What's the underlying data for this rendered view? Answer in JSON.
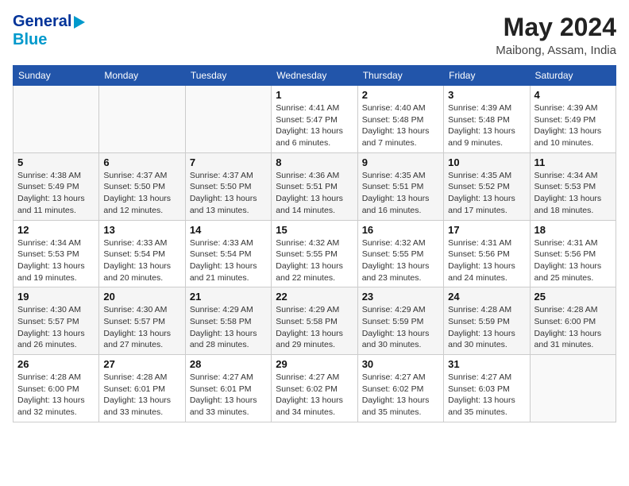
{
  "header": {
    "logo_line1": "General",
    "logo_line2": "Blue",
    "month_year": "May 2024",
    "location": "Maibong, Assam, India"
  },
  "weekdays": [
    "Sunday",
    "Monday",
    "Tuesday",
    "Wednesday",
    "Thursday",
    "Friday",
    "Saturday"
  ],
  "weeks": [
    [
      {
        "day": "",
        "info": ""
      },
      {
        "day": "",
        "info": ""
      },
      {
        "day": "",
        "info": ""
      },
      {
        "day": "1",
        "info": "Sunrise: 4:41 AM\nSunset: 5:47 PM\nDaylight: 13 hours\nand 6 minutes."
      },
      {
        "day": "2",
        "info": "Sunrise: 4:40 AM\nSunset: 5:48 PM\nDaylight: 13 hours\nand 7 minutes."
      },
      {
        "day": "3",
        "info": "Sunrise: 4:39 AM\nSunset: 5:48 PM\nDaylight: 13 hours\nand 9 minutes."
      },
      {
        "day": "4",
        "info": "Sunrise: 4:39 AM\nSunset: 5:49 PM\nDaylight: 13 hours\nand 10 minutes."
      }
    ],
    [
      {
        "day": "5",
        "info": "Sunrise: 4:38 AM\nSunset: 5:49 PM\nDaylight: 13 hours\nand 11 minutes."
      },
      {
        "day": "6",
        "info": "Sunrise: 4:37 AM\nSunset: 5:50 PM\nDaylight: 13 hours\nand 12 minutes."
      },
      {
        "day": "7",
        "info": "Sunrise: 4:37 AM\nSunset: 5:50 PM\nDaylight: 13 hours\nand 13 minutes."
      },
      {
        "day": "8",
        "info": "Sunrise: 4:36 AM\nSunset: 5:51 PM\nDaylight: 13 hours\nand 14 minutes."
      },
      {
        "day": "9",
        "info": "Sunrise: 4:35 AM\nSunset: 5:51 PM\nDaylight: 13 hours\nand 16 minutes."
      },
      {
        "day": "10",
        "info": "Sunrise: 4:35 AM\nSunset: 5:52 PM\nDaylight: 13 hours\nand 17 minutes."
      },
      {
        "day": "11",
        "info": "Sunrise: 4:34 AM\nSunset: 5:53 PM\nDaylight: 13 hours\nand 18 minutes."
      }
    ],
    [
      {
        "day": "12",
        "info": "Sunrise: 4:34 AM\nSunset: 5:53 PM\nDaylight: 13 hours\nand 19 minutes."
      },
      {
        "day": "13",
        "info": "Sunrise: 4:33 AM\nSunset: 5:54 PM\nDaylight: 13 hours\nand 20 minutes."
      },
      {
        "day": "14",
        "info": "Sunrise: 4:33 AM\nSunset: 5:54 PM\nDaylight: 13 hours\nand 21 minutes."
      },
      {
        "day": "15",
        "info": "Sunrise: 4:32 AM\nSunset: 5:55 PM\nDaylight: 13 hours\nand 22 minutes."
      },
      {
        "day": "16",
        "info": "Sunrise: 4:32 AM\nSunset: 5:55 PM\nDaylight: 13 hours\nand 23 minutes."
      },
      {
        "day": "17",
        "info": "Sunrise: 4:31 AM\nSunset: 5:56 PM\nDaylight: 13 hours\nand 24 minutes."
      },
      {
        "day": "18",
        "info": "Sunrise: 4:31 AM\nSunset: 5:56 PM\nDaylight: 13 hours\nand 25 minutes."
      }
    ],
    [
      {
        "day": "19",
        "info": "Sunrise: 4:30 AM\nSunset: 5:57 PM\nDaylight: 13 hours\nand 26 minutes."
      },
      {
        "day": "20",
        "info": "Sunrise: 4:30 AM\nSunset: 5:57 PM\nDaylight: 13 hours\nand 27 minutes."
      },
      {
        "day": "21",
        "info": "Sunrise: 4:29 AM\nSunset: 5:58 PM\nDaylight: 13 hours\nand 28 minutes."
      },
      {
        "day": "22",
        "info": "Sunrise: 4:29 AM\nSunset: 5:58 PM\nDaylight: 13 hours\nand 29 minutes."
      },
      {
        "day": "23",
        "info": "Sunrise: 4:29 AM\nSunset: 5:59 PM\nDaylight: 13 hours\nand 30 minutes."
      },
      {
        "day": "24",
        "info": "Sunrise: 4:28 AM\nSunset: 5:59 PM\nDaylight: 13 hours\nand 30 minutes."
      },
      {
        "day": "25",
        "info": "Sunrise: 4:28 AM\nSunset: 6:00 PM\nDaylight: 13 hours\nand 31 minutes."
      }
    ],
    [
      {
        "day": "26",
        "info": "Sunrise: 4:28 AM\nSunset: 6:00 PM\nDaylight: 13 hours\nand 32 minutes."
      },
      {
        "day": "27",
        "info": "Sunrise: 4:28 AM\nSunset: 6:01 PM\nDaylight: 13 hours\nand 33 minutes."
      },
      {
        "day": "28",
        "info": "Sunrise: 4:27 AM\nSunset: 6:01 PM\nDaylight: 13 hours\nand 33 minutes."
      },
      {
        "day": "29",
        "info": "Sunrise: 4:27 AM\nSunset: 6:02 PM\nDaylight: 13 hours\nand 34 minutes."
      },
      {
        "day": "30",
        "info": "Sunrise: 4:27 AM\nSunset: 6:02 PM\nDaylight: 13 hours\nand 35 minutes."
      },
      {
        "day": "31",
        "info": "Sunrise: 4:27 AM\nSunset: 6:03 PM\nDaylight: 13 hours\nand 35 minutes."
      },
      {
        "day": "",
        "info": ""
      }
    ]
  ]
}
